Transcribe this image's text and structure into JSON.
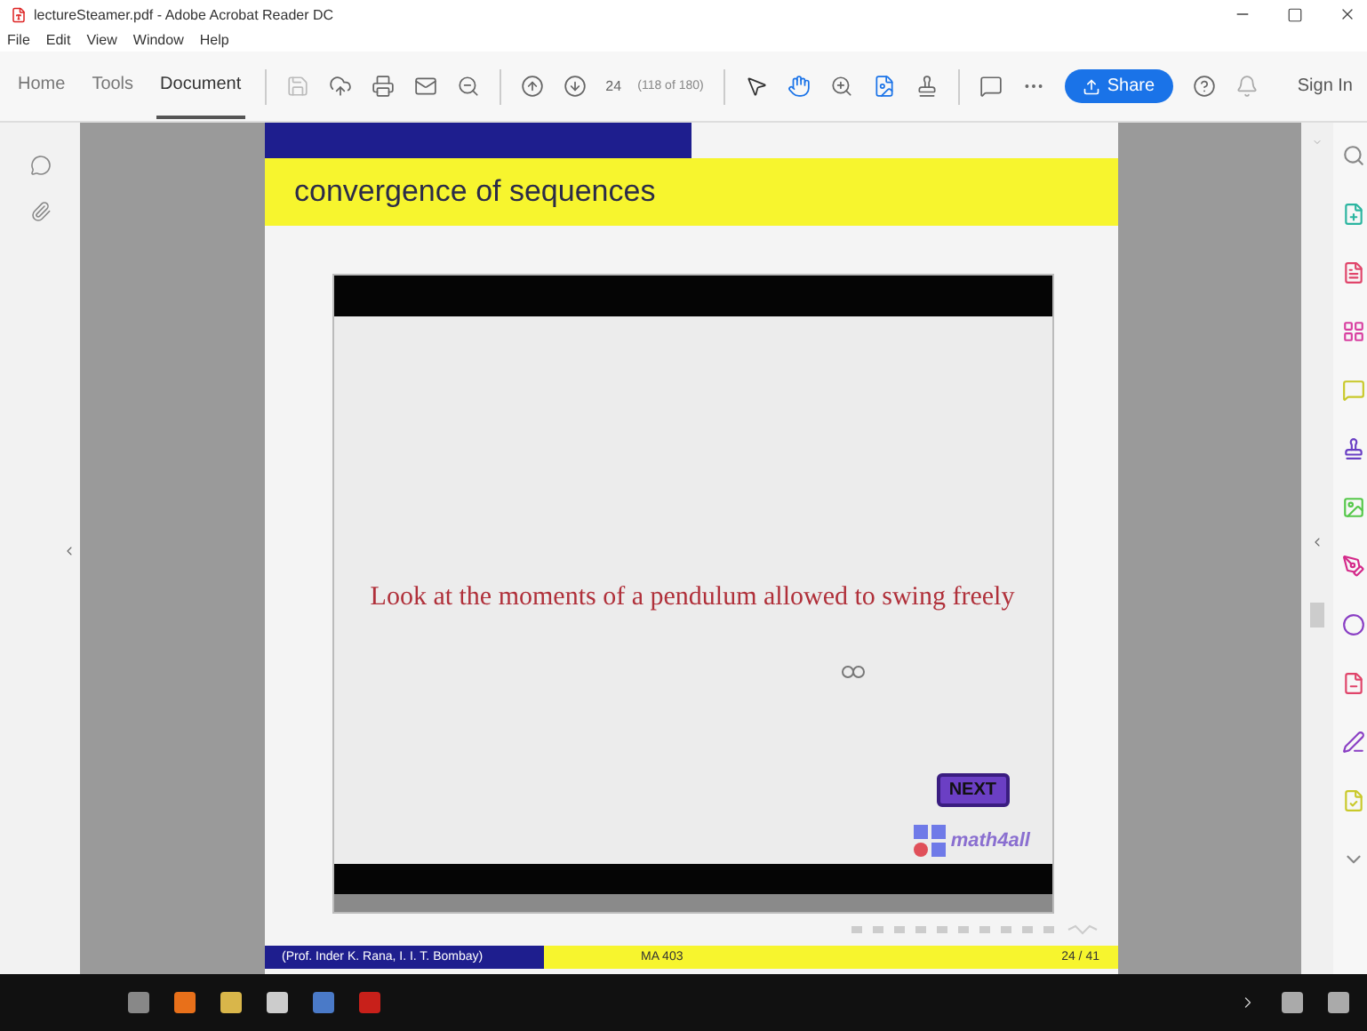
{
  "window": {
    "title": "lectureSteamer.pdf - Adobe Acrobat Reader DC"
  },
  "menu": [
    "File",
    "Edit",
    "View",
    "Window",
    "Help"
  ],
  "tabs": [
    {
      "label": "Home",
      "selected": false
    },
    {
      "label": "Tools",
      "selected": false
    },
    {
      "label": "Document",
      "selected": true
    }
  ],
  "page_nav": {
    "value": "24",
    "count": "(118 of 180)"
  },
  "share_button": "Share",
  "sign_in": "Sign In",
  "slide": {
    "title": "convergence of sequences",
    "video": {
      "caption": "Look at the moments of a pendulum allowed to swing freely",
      "next_button": "NEXT",
      "logo": "math4all"
    },
    "footer": {
      "author": "(Prof. Inder K. Rana, I. I. T. Bombay)",
      "course": "MA 403",
      "page": "24 / 41"
    }
  }
}
